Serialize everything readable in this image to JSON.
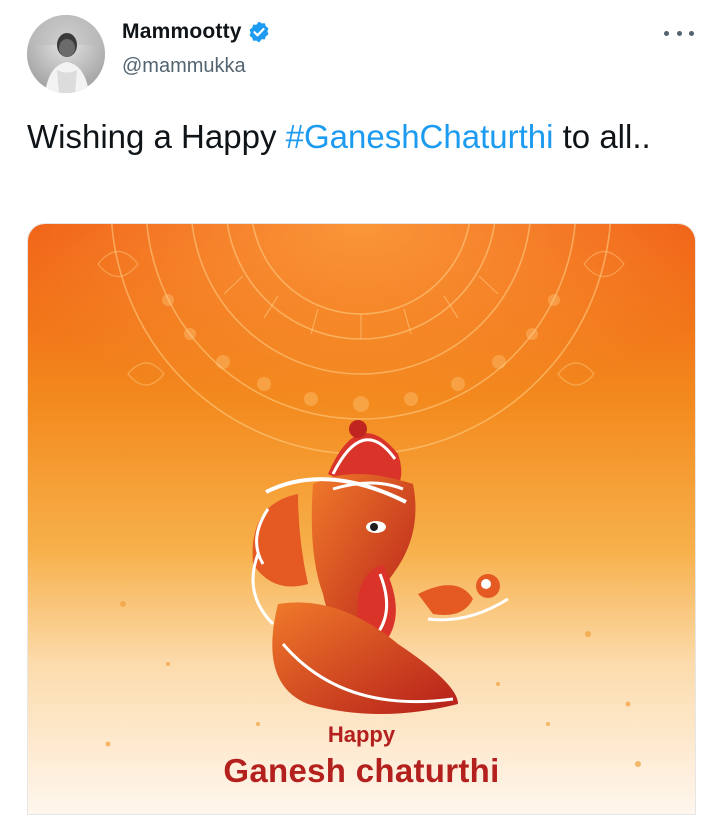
{
  "tweet": {
    "author": {
      "display_name": "Mammootty",
      "handle": "@mammukka",
      "verified": true
    },
    "more_icon": "more-options-icon",
    "text_prefix": "Wishing a Happy ",
    "hashtag": "#GaneshChaturthi",
    "text_suffix": " to all..",
    "media": {
      "caption_line1": "Happy",
      "caption_line2": "Ganesh chaturthi"
    }
  },
  "colors": {
    "hashtag": "#1d9bf0",
    "verified_badge": "#1d9bf0",
    "caption": "#b3201d",
    "background_orange": "#ef6a18"
  }
}
